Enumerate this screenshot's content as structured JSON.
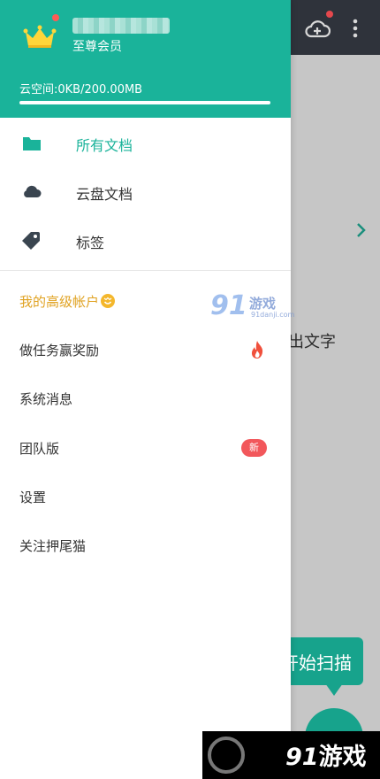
{
  "background": {
    "partial_text": "出文字",
    "scan_button_label": "开始扫描"
  },
  "drawer": {
    "header": {
      "member_level": "至尊会员",
      "storage_text": "云空间:0KB/200.00MB",
      "storage_used_fraction": 0.0
    },
    "nav": [
      {
        "label": "所有文档",
        "icon": "folder-icon",
        "active": true
      },
      {
        "label": "云盘文档",
        "icon": "cloud-icon",
        "active": false
      },
      {
        "label": "标签",
        "icon": "tag-icon",
        "active": false
      }
    ],
    "menu": [
      {
        "label": "我的高级帐户",
        "badge": "smile-badge"
      },
      {
        "label": "做任务赢奖励",
        "badge": "fire-icon"
      },
      {
        "label": "系统消息"
      },
      {
        "label": "团队版",
        "badge_text": "新"
      },
      {
        "label": "设置"
      },
      {
        "label": "关注押尾猫"
      }
    ]
  },
  "watermark": {
    "mid_logo": "91",
    "mid_text": "游戏",
    "mid_url": "91danji.com",
    "bottom_logo_num": "91",
    "bottom_logo_text": "游戏"
  },
  "colors": {
    "accent": "#1ab39a",
    "premium": "#e0a221",
    "badge_red": "#f2575b",
    "topbar_dark": "#2f333b"
  }
}
